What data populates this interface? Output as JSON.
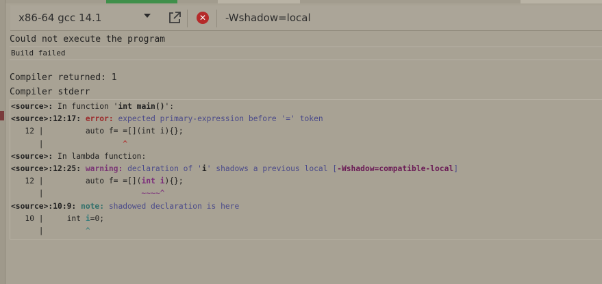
{
  "toolbar": {
    "compiler": "x86-64 gcc 14.1",
    "flags_value": "-Wshadow=local",
    "popout_icon": "external-link-icon",
    "clear_icon": "close-circle-icon"
  },
  "output": {
    "exec_status": "Could not execute the program",
    "build_status": "Build failed",
    "returned": "Compiler returned: 1",
    "stderr_header": "Compiler stderr"
  },
  "stderr": {
    "l1_pre": "<source>:",
    "l1_mid": " In function '",
    "l1_fn": "int main()",
    "l1_post": "':",
    "l2_loc": "<source>:12:17:",
    "l2_kind": "error:",
    "l2_msg": " expected primary-expression before '=' token",
    "l3": "   12 |         auto f= =[](int i){};",
    "l4_bar": "      |",
    "l4_caret": "                 ^",
    "l5_pre": "<source>:",
    "l5_msg": " In lambda function:",
    "l6_loc": "<source>:12:25:",
    "l6_kind": "warning:",
    "l6_a": " declaration of '",
    "l6_i": "i",
    "l6_b": "' shadows a previous local [",
    "l6_flag": "-Wshadow=compatible-local",
    "l6_c": "]",
    "l7_a": "   12 |         auto f= =[](",
    "l7_b": "int i",
    "l7_c": "){};",
    "l8_bar": "      |",
    "l8_mark": "                     ~~~~^",
    "l9_loc": "<source>:10:9:",
    "l9_kind": "note:",
    "l9_msg": " shadowed declaration is here",
    "l10_a": "   10 |     int ",
    "l10_b": "i",
    "l10_c": "=0;",
    "l11_bar": "      |",
    "l11_caret": "         ^"
  },
  "colors": {
    "background": "#a8a294",
    "error": "#9b2b2b",
    "warning": "#7a3575",
    "note": "#2f6f6a",
    "tab_active": "#3f8f4a",
    "clear_button": "#b52a2a"
  }
}
